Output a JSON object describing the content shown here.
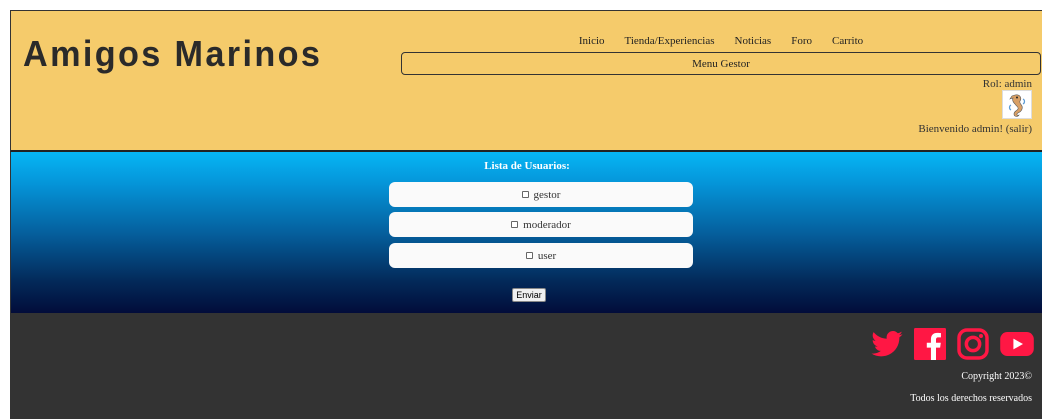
{
  "header": {
    "logo": "Amigos Marinos",
    "nav": [
      {
        "label": "Inicio"
      },
      {
        "label": "Tienda/Experiencias"
      },
      {
        "label": "Noticias"
      },
      {
        "label": "Foro"
      },
      {
        "label": "Carrito"
      }
    ],
    "gestor_menu": "Menu Gestor",
    "role": "Rol: admin",
    "welcome": "Bienvenido admin! (salir)"
  },
  "main": {
    "list_title": "Lista de Usuarios:",
    "users": [
      {
        "label": "gestor",
        "checked": false
      },
      {
        "label": "moderador",
        "checked": false
      },
      {
        "label": "user",
        "checked": false
      }
    ],
    "submit_label": "Enviar"
  },
  "footer": {
    "socials": [
      "twitter-icon",
      "facebook-icon",
      "instagram-icon",
      "youtube-icon"
    ],
    "social_color": "#ff1744",
    "copyright": "Copyright 2023©",
    "rights": "Todos los derechos reservados"
  },
  "colors": {
    "header_bg": "#f5cb6b",
    "footer_bg": "#333333",
    "gradient_top": "#06b6f5",
    "gradient_bottom": "#020c3a"
  }
}
